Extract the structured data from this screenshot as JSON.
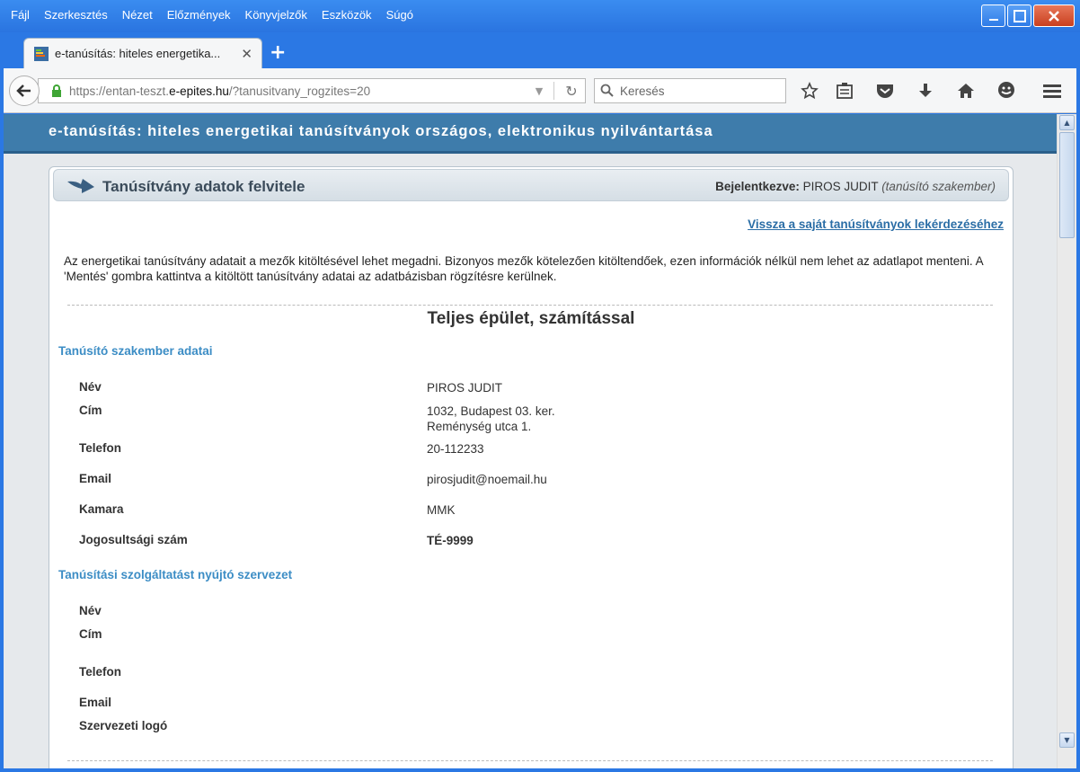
{
  "menu": [
    "Fájl",
    "Szerkesztés",
    "Nézet",
    "Előzmények",
    "Könyvjelzők",
    "Eszközök",
    "Súgó"
  ],
  "tab": {
    "title": "e-tanúsítás: hiteles energetika...",
    "close": "✕",
    "new": "+"
  },
  "url": {
    "prefix": "https://entan-teszt.",
    "host": "e-epites.hu",
    "path": "/?tanusitvany_rogzites=20"
  },
  "search": {
    "placeholder": "Keresés"
  },
  "site": {
    "header": "e-tanúsítás: hiteles energetikai tanúsítványok országos, elektronikus nyilvántartása"
  },
  "panel": {
    "title": "Tanúsítvány adatok felvitele",
    "logged_label": "Bejelentkezve:",
    "logged_user": "PIROS JUDIT",
    "logged_role": "(tanúsító szakember)"
  },
  "backlink": "Vissza a saját tanúsítványok lekérdezéséhez",
  "intro": "Az energetikai tanúsítvány adatait a mezők kitöltésével lehet megadni. Bizonyos mezők kötelezően kitöltendőek, ezen információk nélkül nem lehet az adatlapot menteni. A 'Mentés' gombra kattintva a kitöltött tanúsítvány adatai az adatbázisban rögzítésre kerülnek.",
  "section_title": "Teljes épület, számítással",
  "expert": {
    "heading": "Tanúsító szakember adatai",
    "labels": {
      "name": "Név",
      "address": "Cím",
      "phone": "Telefon",
      "email": "Email",
      "chamber": "Kamara",
      "license": "Jogosultsági szám"
    },
    "values": {
      "name": "PIROS JUDIT",
      "address1": "1032, Budapest 03. ker.",
      "address2": "Reménység utca 1.",
      "phone": "20-112233",
      "email": "pirosjudit@noemail.hu",
      "chamber": "MMK",
      "license": "TÉ-9999"
    }
  },
  "org": {
    "heading": "Tanúsítási szolgáltatást nyújtó szervezet",
    "labels": {
      "name": "Név",
      "address": "Cím",
      "phone": "Telefon",
      "email": "Email",
      "logo": "Szervezeti logó"
    }
  }
}
